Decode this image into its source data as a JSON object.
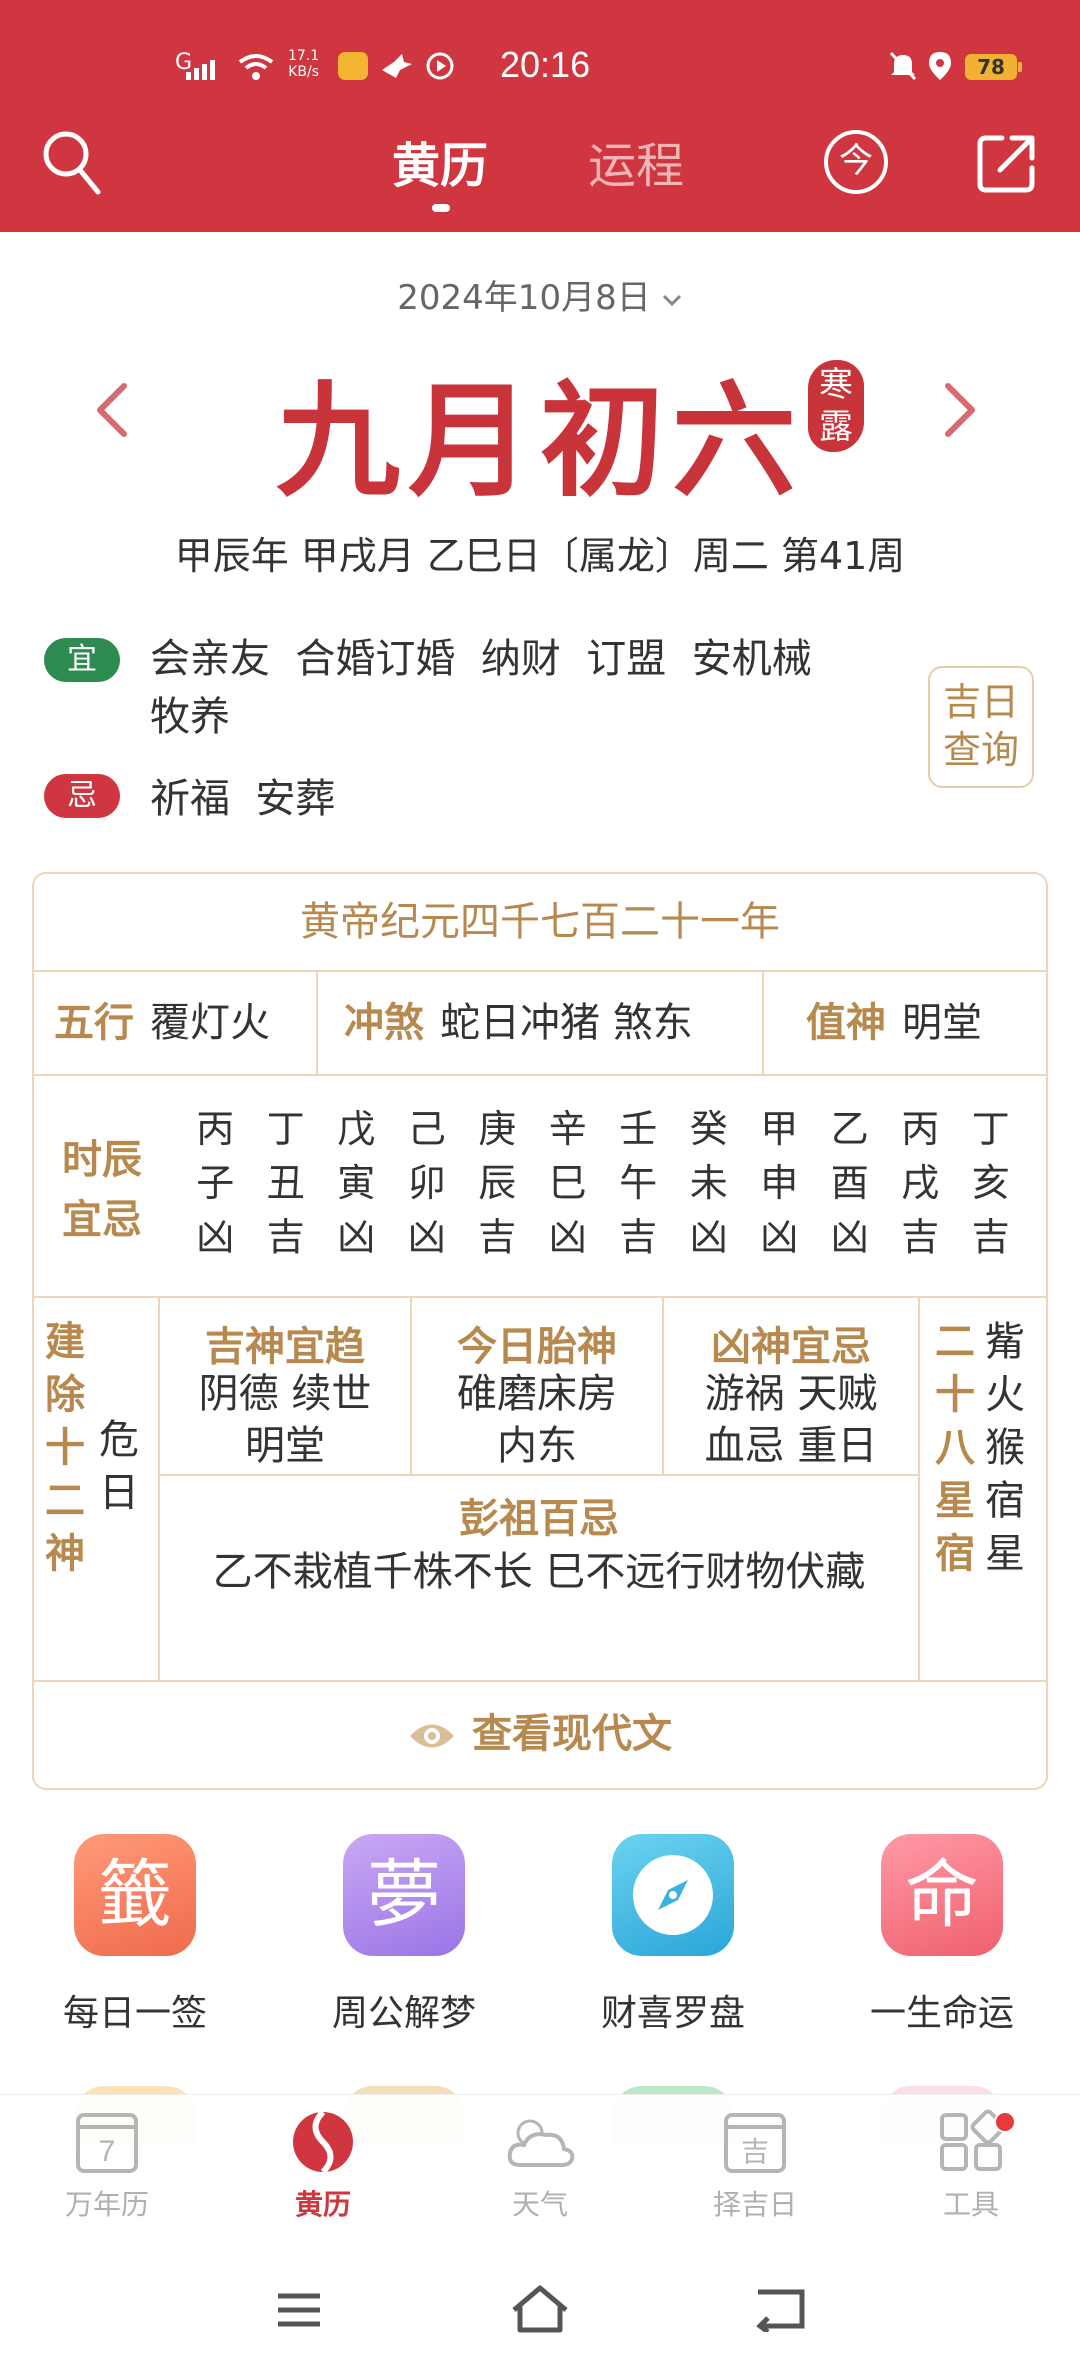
{
  "status_bar": {
    "signal": "G",
    "net_speed_value": "17.1",
    "net_speed_unit": "KB/s",
    "time": "20:16",
    "battery": "78"
  },
  "nav": {
    "tab_active": "黄历",
    "tab_inactive": "运程",
    "today_glyph": "今"
  },
  "date": {
    "solar": "2024年10月8日",
    "lunar": "九月初六",
    "solar_term": [
      "寒",
      "露"
    ],
    "ganzhi": "甲辰年 甲戌月 乙巳日〔属龙〕周二 第41周"
  },
  "yi": {
    "badge": "宜",
    "line1": "会亲友  合婚订婚  纳财  订盟  安机械",
    "line2": "牧养"
  },
  "ji": {
    "badge": "忌",
    "text": "祈福  安葬"
  },
  "jiri_button": [
    "吉日",
    "查询"
  ],
  "almanac": {
    "title": "黄帝纪元四千七百二十一年",
    "wuxing_label": "五行",
    "wuxing_value": "覆灯火",
    "chongsha_label": "冲煞",
    "chongsha_value": "蛇日冲猪 煞东",
    "zhishen_label": "值神",
    "zhishen_value": "明堂",
    "shichen_label": [
      "时辰",
      "宜忌"
    ],
    "shichen": [
      {
        "gan": "丙",
        "zhi": "子",
        "luck": "凶"
      },
      {
        "gan": "丁",
        "zhi": "丑",
        "luck": "吉"
      },
      {
        "gan": "戊",
        "zhi": "寅",
        "luck": "凶"
      },
      {
        "gan": "己",
        "zhi": "卯",
        "luck": "凶"
      },
      {
        "gan": "庚",
        "zhi": "辰",
        "luck": "吉"
      },
      {
        "gan": "辛",
        "zhi": "巳",
        "luck": "凶"
      },
      {
        "gan": "壬",
        "zhi": "午",
        "luck": "吉"
      },
      {
        "gan": "癸",
        "zhi": "未",
        "luck": "凶"
      },
      {
        "gan": "甲",
        "zhi": "申",
        "luck": "凶"
      },
      {
        "gan": "乙",
        "zhi": "酉",
        "luck": "凶"
      },
      {
        "gan": "丙",
        "zhi": "戌",
        "luck": "吉"
      },
      {
        "gan": "丁",
        "zhi": "亥",
        "luck": "吉"
      }
    ],
    "jianchu_label": "建除十二神",
    "jianchu_value": "危日",
    "jishen_label": "吉神宜趋",
    "jishen_line1": "阴德 续世",
    "jishen_line2": "明堂",
    "taishen_label": "今日胎神",
    "taishen_line1": "碓磨床房",
    "taishen_line2": "内东",
    "xiongshen_label": "凶神宜忌",
    "xiongshen_line1": "游祸 天贼",
    "xiongshen_line2": "血忌 重日",
    "xingxiu_label": "二十八星宿",
    "xingxiu_value": "觜火猴宿星",
    "pengzu_label": "彭祖百忌",
    "pengzu_text": "乙不栽植千株不长 巳不远行财物伏藏",
    "view_modern": "查看现代文"
  },
  "tools": [
    {
      "glyph": "籤",
      "label": "每日一签"
    },
    {
      "glyph": "夢",
      "label": "周公解梦"
    },
    {
      "glyph": "",
      "label": "财喜罗盘"
    },
    {
      "glyph": "命",
      "label": "一生命运"
    }
  ],
  "tabbar": [
    {
      "label": "万年历",
      "icon_text": "7"
    },
    {
      "label": "黄历"
    },
    {
      "label": "天气"
    },
    {
      "label": "择吉日",
      "icon_text": "吉"
    },
    {
      "label": "工具"
    }
  ],
  "colors": {
    "brand_red": "#d0363f",
    "gold": "#b8894f",
    "yi_green": "#2e8b50"
  }
}
